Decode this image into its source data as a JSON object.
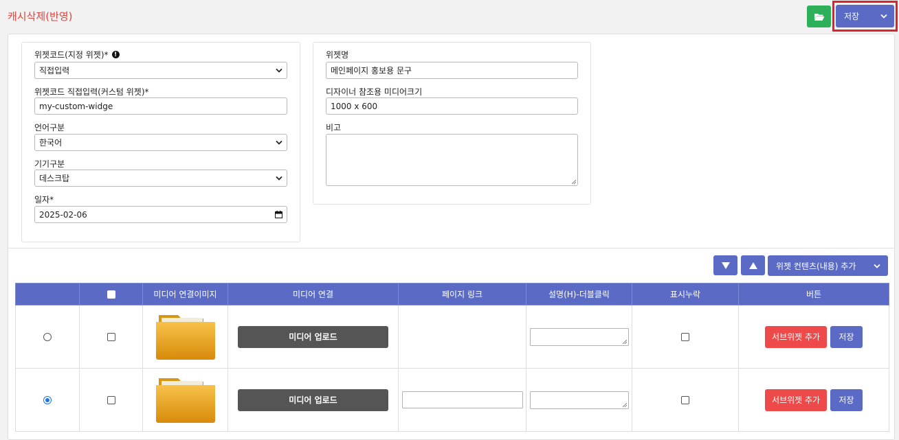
{
  "page": {
    "title": "캐시삭제(반영)"
  },
  "toolbar": {
    "folder_icon": "folder-open-icon",
    "save_label": "저장",
    "save_menu_icon": "chevron-down-icon",
    "highlight_color": "#e0212a"
  },
  "form": {
    "widget_code": {
      "label": "위젯코드(지정 위젯)*",
      "value": "직접입력"
    },
    "widget_code_custom": {
      "label": "위젯코드 직접입력(커스텀 위젯)*",
      "value": "my-custom-widge"
    },
    "language": {
      "label": "언어구분",
      "value": "한국어"
    },
    "device": {
      "label": "기기구분",
      "value": "데스크탑"
    },
    "date": {
      "label": "일자*",
      "value": "2025-02-06"
    },
    "widget_name": {
      "label": "위젯명",
      "value": "메인페이지 홍보용 문구"
    },
    "media_size": {
      "label": "디자이너 참조용 미디어크기",
      "value": "1000 x 600"
    },
    "remarks": {
      "label": "비고",
      "value": ""
    }
  },
  "content_toolbar": {
    "move_down_icon": "triangle-down-icon",
    "move_up_icon": "triangle-up-icon",
    "add_label": "위젯 컨텐츠(내용) 추가"
  },
  "table": {
    "columns": [
      "",
      "",
      "미디어 연결이미지",
      "미디어 연결",
      "페이지 링크",
      "설명(H)-더블클릭",
      "표시누락",
      "버튼"
    ],
    "rows": [
      {
        "selected": false,
        "upload_label": "미디어 업로드",
        "has_link_input": false,
        "sub_widget_label": "서브위젯 추가",
        "save_label": "저장"
      },
      {
        "selected": true,
        "upload_label": "미디어 업로드",
        "has_link_input": true,
        "sub_widget_label": "서브위젯 추가",
        "save_label": "저장"
      }
    ]
  },
  "colors": {
    "primary": "#5b6bc5",
    "danger": "#ee4a4a",
    "success": "#2eb05b",
    "title": "#e8413b"
  }
}
